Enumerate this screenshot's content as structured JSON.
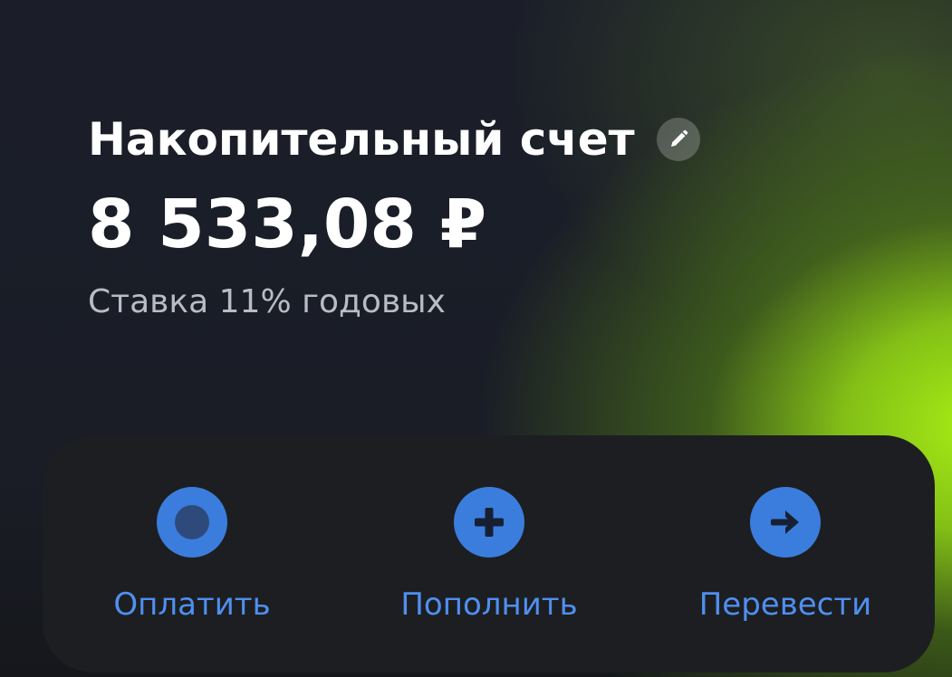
{
  "account": {
    "title": "Накопительный счет",
    "balance": "8 533,08 ₽",
    "rate": "Ставка 11% годовых"
  },
  "actions": [
    {
      "label": "Оплатить",
      "icon": "record-circle-icon"
    },
    {
      "label": "Пополнить",
      "icon": "plus-icon"
    },
    {
      "label": "Перевести",
      "icon": "arrow-right-icon"
    }
  ],
  "colors": {
    "accent": "#3b7ddd",
    "accent_text": "#4f8ff0",
    "panel": "#1d1e21",
    "glow": "#aaf014"
  }
}
